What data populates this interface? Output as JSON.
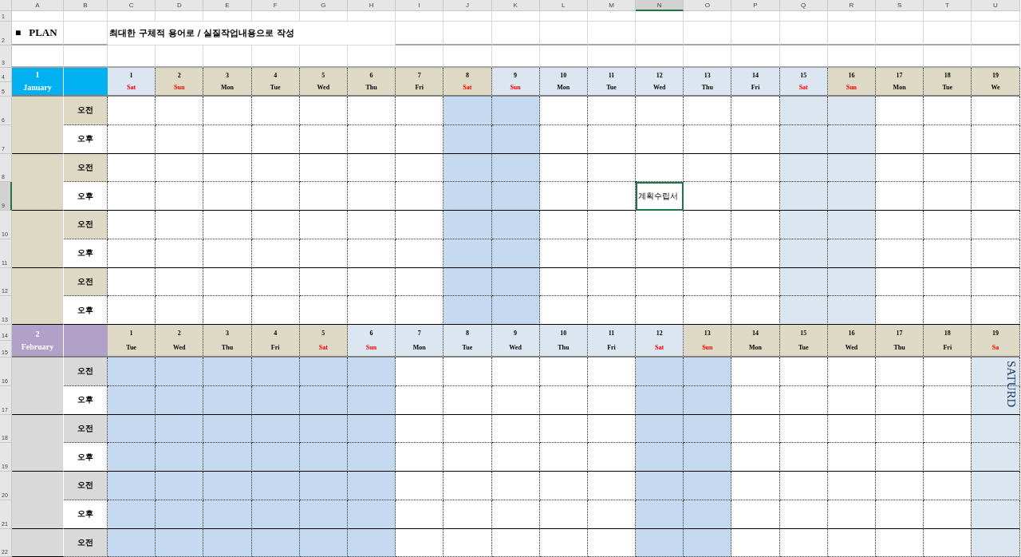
{
  "columns": [
    {
      "letter": "A",
      "selected": false
    },
    {
      "letter": "B",
      "selected": false
    },
    {
      "letter": "C",
      "selected": false
    },
    {
      "letter": "D",
      "selected": false
    },
    {
      "letter": "E",
      "selected": false
    },
    {
      "letter": "F",
      "selected": false
    },
    {
      "letter": "G",
      "selected": false
    },
    {
      "letter": "H",
      "selected": false
    },
    {
      "letter": "I",
      "selected": false
    },
    {
      "letter": "J",
      "selected": false
    },
    {
      "letter": "K",
      "selected": false
    },
    {
      "letter": "L",
      "selected": false
    },
    {
      "letter": "M",
      "selected": false
    },
    {
      "letter": "N",
      "selected": true
    },
    {
      "letter": "O",
      "selected": false
    },
    {
      "letter": "P",
      "selected": false
    },
    {
      "letter": "Q",
      "selected": false
    },
    {
      "letter": "R",
      "selected": false
    },
    {
      "letter": "S",
      "selected": false
    },
    {
      "letter": "T",
      "selected": false
    },
    {
      "letter": "U",
      "selected": false
    }
  ],
  "rows": [
    {
      "number": "1",
      "selected": false
    },
    {
      "number": "2",
      "selected": false
    },
    {
      "number": "3",
      "selected": false
    },
    {
      "number": "4",
      "selected": false
    },
    {
      "number": "5",
      "selected": false
    },
    {
      "number": "6",
      "selected": false
    },
    {
      "number": "7",
      "selected": false
    },
    {
      "number": "8",
      "selected": false
    },
    {
      "number": "9",
      "selected": true
    },
    {
      "number": "10",
      "selected": false
    },
    {
      "number": "11",
      "selected": false
    },
    {
      "number": "12",
      "selected": false
    },
    {
      "number": "13",
      "selected": false
    },
    {
      "number": "14",
      "selected": false
    },
    {
      "number": "15",
      "selected": false
    },
    {
      "number": "16",
      "selected": false
    },
    {
      "number": "17",
      "selected": false
    },
    {
      "number": "18",
      "selected": false
    },
    {
      "number": "19",
      "selected": false
    },
    {
      "number": "20",
      "selected": false
    },
    {
      "number": "21",
      "selected": false
    },
    {
      "number": "22",
      "selected": false
    }
  ],
  "title": {
    "bullet": "■",
    "label": "PLAN",
    "instruction": "최대한 구체적 용어로 / 실질작업내용으로 작성"
  },
  "active_cell_text": "계획수립서",
  "months": [
    {
      "number": "1",
      "name": "January",
      "color": "#00b0f0",
      "block": {
        "color": "#ddd9c4"
      },
      "days": [
        {
          "day": "1",
          "weekday": "Sat",
          "holiday": true,
          "color": "#dce6f1"
        },
        {
          "day": "2",
          "weekday": "Sun",
          "holiday": true,
          "color": "#ddd9c4"
        },
        {
          "day": "3",
          "weekday": "Mon",
          "holiday": false,
          "color": "#ddd9c4"
        },
        {
          "day": "4",
          "weekday": "Tue",
          "holiday": false,
          "color": "#ddd9c4"
        },
        {
          "day": "5",
          "weekday": "Wed",
          "holiday": false,
          "color": "#ddd9c4"
        },
        {
          "day": "6",
          "weekday": "Thu",
          "holiday": false,
          "color": "#ddd9c4"
        },
        {
          "day": "7",
          "weekday": "Fri",
          "holiday": false,
          "color": "#ddd9c4"
        },
        {
          "day": "8",
          "weekday": "Sat",
          "holiday": true,
          "color": "#ddd9c4",
          "column": {
            "color": "#c5d9f1"
          }
        },
        {
          "day": "9",
          "weekday": "Sun",
          "holiday": true,
          "color": "#dce6f1",
          "column": {
            "color": "#c5d9f1"
          }
        },
        {
          "day": "10",
          "weekday": "Mon",
          "holiday": false,
          "color": "#dce6f1"
        },
        {
          "day": "11",
          "weekday": "Tue",
          "holiday": false,
          "color": "#dce6f1"
        },
        {
          "day": "12",
          "weekday": "Wed",
          "holiday": false,
          "color": "#dce6f1"
        },
        {
          "day": "13",
          "weekday": "Thu",
          "holiday": false,
          "color": "#dce6f1"
        },
        {
          "day": "14",
          "weekday": "Fri",
          "holiday": false,
          "color": "#dce6f1"
        },
        {
          "day": "15",
          "weekday": "Sat",
          "holiday": true,
          "color": "#dce6f1",
          "column": {
            "color": "#dce6f1"
          }
        },
        {
          "day": "16",
          "weekday": "Sun",
          "holiday": true,
          "color": "#ddd9c4",
          "column": {
            "color": "#dce6f1"
          }
        },
        {
          "day": "17",
          "weekday": "Mon",
          "holiday": false,
          "color": "#ddd9c4"
        },
        {
          "day": "18",
          "weekday": "Tue",
          "holiday": false,
          "color": "#ddd9c4"
        },
        {
          "day": "19",
          "weekday": "We",
          "holiday": false,
          "color": "#ddd9c4"
        }
      ],
      "blocks": [
        {
          "slots": [
            {
              "label": "오전"
            },
            {
              "label": "오후"
            }
          ]
        },
        {
          "slots": [
            {
              "label": "오전"
            },
            {
              "label": "오후"
            }
          ]
        },
        {
          "slots": [
            {
              "label": "오전"
            },
            {
              "label": "오후"
            }
          ]
        },
        {
          "slots": [
            {
              "label": "오전"
            },
            {
              "label": "오후"
            }
          ]
        }
      ]
    },
    {
      "number": "2",
      "name": "February",
      "color": "#b1a0c7",
      "block": {
        "color": "#d9d9d9"
      },
      "days": [
        {
          "day": "1",
          "weekday": "Tue",
          "holiday": false,
          "color": "#ddd9c4",
          "column": {
            "color": "#c5d9f1"
          }
        },
        {
          "day": "2",
          "weekday": "Wed",
          "holiday": false,
          "color": "#ddd9c4",
          "column": {
            "color": "#c5d9f1"
          }
        },
        {
          "day": "3",
          "weekday": "Thu",
          "holiday": false,
          "color": "#ddd9c4",
          "column": {
            "color": "#c5d9f1"
          }
        },
        {
          "day": "4",
          "weekday": "Fri",
          "holiday": false,
          "color": "#ddd9c4",
          "column": {
            "color": "#c5d9f1"
          }
        },
        {
          "day": "5",
          "weekday": "Sat",
          "holiday": true,
          "color": "#ddd9c4",
          "column": {
            "color": "#c5d9f1"
          }
        },
        {
          "day": "6",
          "weekday": "Sun",
          "holiday": true,
          "color": "#dce6f1",
          "column": {
            "color": "#c5d9f1"
          }
        },
        {
          "day": "7",
          "weekday": "Mon",
          "holiday": false,
          "color": "#dce6f1"
        },
        {
          "day": "8",
          "weekday": "Tue",
          "holiday": false,
          "color": "#dce6f1"
        },
        {
          "day": "9",
          "weekday": "Wed",
          "holiday": false,
          "color": "#dce6f1"
        },
        {
          "day": "10",
          "weekday": "Thu",
          "holiday": false,
          "color": "#dce6f1"
        },
        {
          "day": "11",
          "weekday": "Fri",
          "holiday": false,
          "color": "#dce6f1"
        },
        {
          "day": "12",
          "weekday": "Sat",
          "holiday": true,
          "color": "#dce6f1",
          "column": {
            "color": "#c5d9f1"
          }
        },
        {
          "day": "13",
          "weekday": "Sun",
          "holiday": true,
          "color": "#ddd9c4",
          "column": {
            "color": "#c5d9f1"
          }
        },
        {
          "day": "14",
          "weekday": "Mon",
          "holiday": false,
          "color": "#ddd9c4"
        },
        {
          "day": "15",
          "weekday": "Tue",
          "holiday": false,
          "color": "#ddd9c4"
        },
        {
          "day": "16",
          "weekday": "Wed",
          "holiday": false,
          "color": "#ddd9c4"
        },
        {
          "day": "17",
          "weekday": "Thu",
          "holiday": false,
          "color": "#ddd9c4"
        },
        {
          "day": "18",
          "weekday": "Fri",
          "holiday": false,
          "color": "#ddd9c4"
        },
        {
          "day": "19",
          "weekday": "Sa",
          "holiday": true,
          "color": "#ddd9c4",
          "column": {
            "color": "#dce6f1"
          },
          "vertical_note": "SATURD"
        }
      ],
      "blocks": [
        {
          "slots": [
            {
              "label": "오전"
            },
            {
              "label": "오후"
            }
          ]
        },
        {
          "slots": [
            {
              "label": "오전"
            },
            {
              "label": "오후"
            }
          ]
        },
        {
          "slots": [
            {
              "label": "오전"
            },
            {
              "label": "오후"
            }
          ]
        },
        {
          "slots": [
            {
              "label": "오전"
            }
          ]
        }
      ]
    }
  ]
}
